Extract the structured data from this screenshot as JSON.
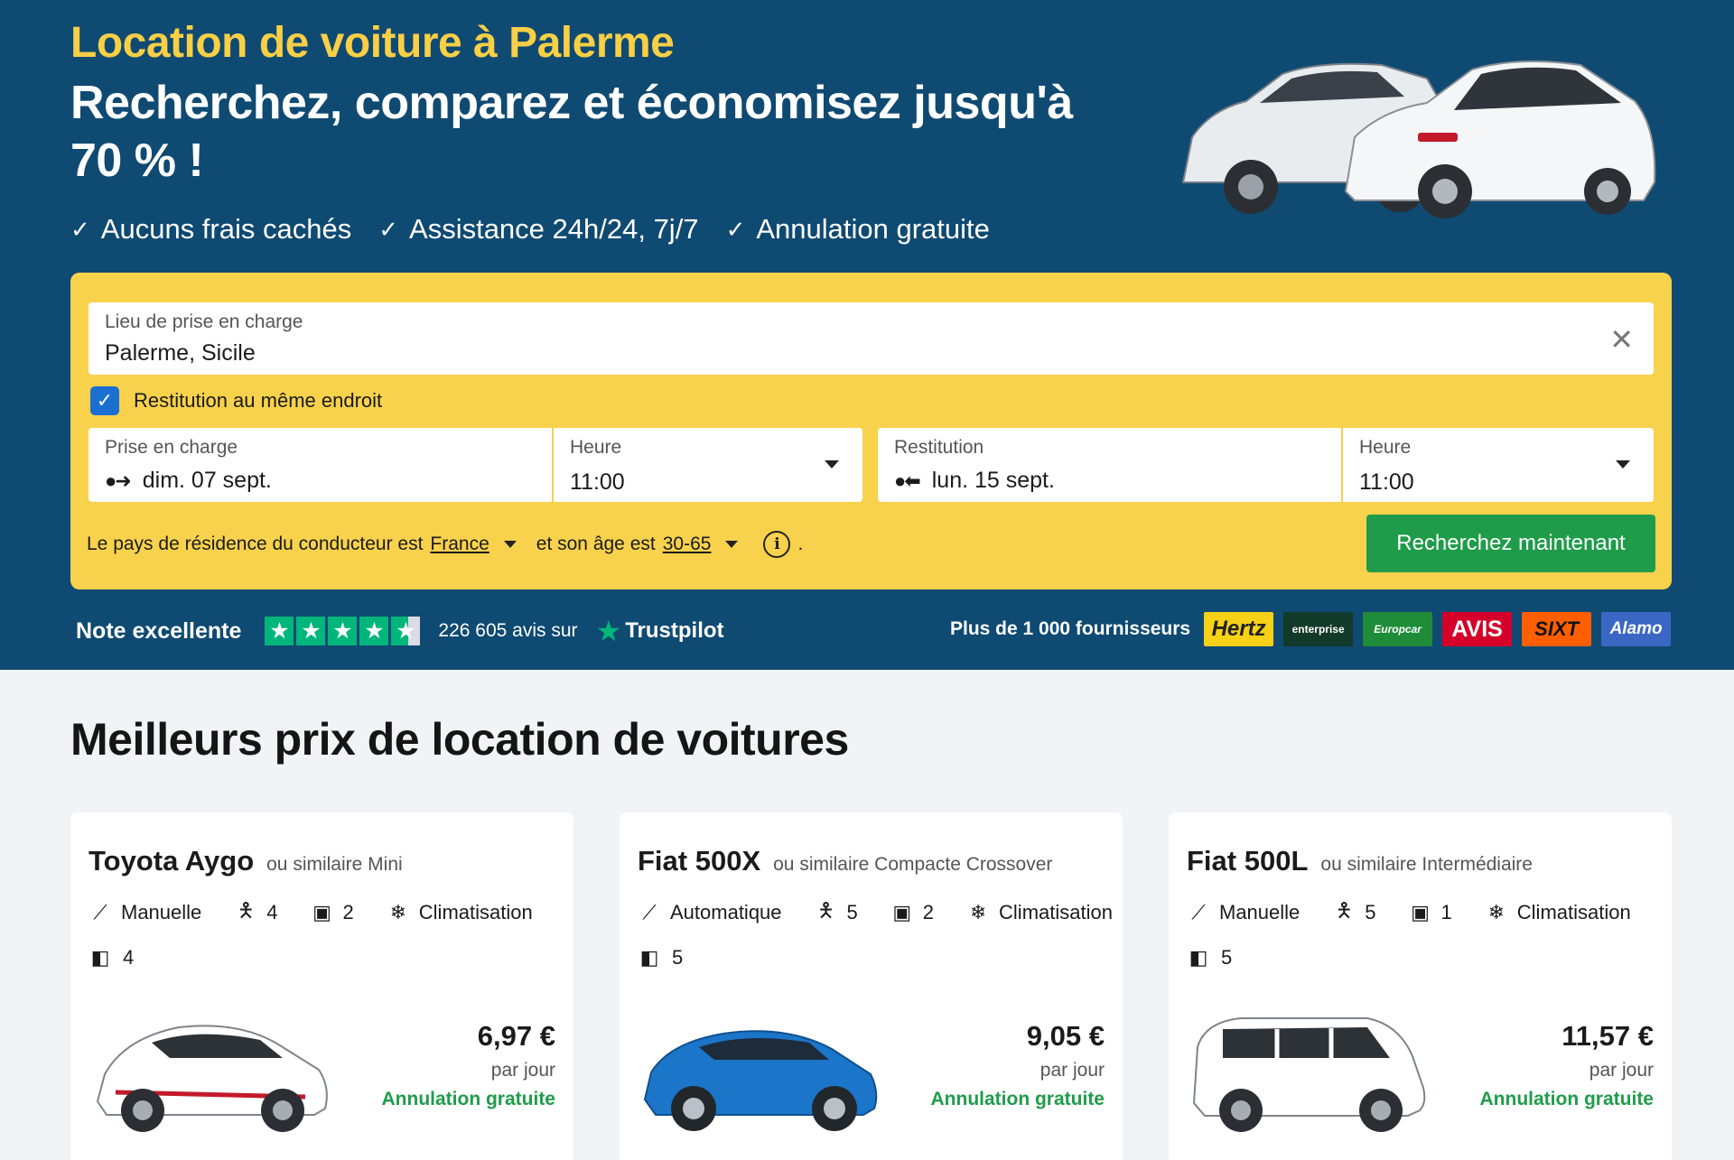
{
  "hero": {
    "title": "Location de voiture à Palerme",
    "subtitle": "Recherchez, comparez et économisez jusqu'à 70 % !",
    "usps": [
      "Aucuns frais cachés",
      "Assistance 24h/24, 7j/7",
      "Annulation gratuite"
    ]
  },
  "search": {
    "location_label": "Lieu de prise en charge",
    "location_value": "Palerme, Sicile",
    "same_return_label": "Restitution au même endroit",
    "same_return_checked": true,
    "pickup_label": "Prise en charge",
    "pickup_date": "dim. 07 sept.",
    "pickup_time_label": "Heure",
    "pickup_time": "11:00",
    "return_label": "Restitution",
    "return_date": "lun. 15 sept.",
    "return_time_label": "Heure",
    "return_time": "11:00",
    "residence_prefix": "Le pays de résidence du conducteur est",
    "residence_country": "France",
    "age_prefix": "et son âge est",
    "age_value": "30-65",
    "age_suffix": ".",
    "search_button": "Recherchez maintenant"
  },
  "rating": {
    "label": "Note excellente",
    "stars": 4.5,
    "reviews": "226 605 avis sur",
    "provider": "Trustpilot"
  },
  "suppliers": {
    "label": "Plus de 1 000 fournisseurs",
    "logos": [
      "Hertz",
      "enterprise",
      "Europcar",
      "AVIS",
      "SIXT",
      "Alamo"
    ]
  },
  "deals": {
    "title": "Meilleurs prix de location de voitures",
    "cards": [
      {
        "model": "Toyota Aygo",
        "category": "ou similaire Mini",
        "transmission": "Manuelle",
        "seats": "4",
        "bags": "2",
        "ac": "Climatisation",
        "doors": "4",
        "price": "6,97 €",
        "per_day": "par jour",
        "cancel": "Annulation gratuite",
        "color": "#ffffff"
      },
      {
        "model": "Fiat 500X",
        "category": "ou similaire Compacte Crossover",
        "transmission": "Automatique",
        "seats": "5",
        "bags": "2",
        "ac": "Climatisation",
        "doors": "5",
        "price": "9,05 €",
        "per_day": "par jour",
        "cancel": "Annulation gratuite",
        "color": "#1b75c9"
      },
      {
        "model": "Fiat 500L",
        "category": "ou similaire Intermédiaire",
        "transmission": "Manuelle",
        "seats": "5",
        "bags": "1",
        "ac": "Climatisation",
        "doors": "5",
        "price": "11,57 €",
        "per_day": "par jour",
        "cancel": "Annulation gratuite",
        "color": "#ffffff"
      }
    ]
  },
  "colors": {
    "hero_bg": "#0f4a72",
    "accent_yellow": "#f8cf45",
    "cta_green": "#1f9c4a",
    "checkbox_blue": "#1b6fd0"
  }
}
